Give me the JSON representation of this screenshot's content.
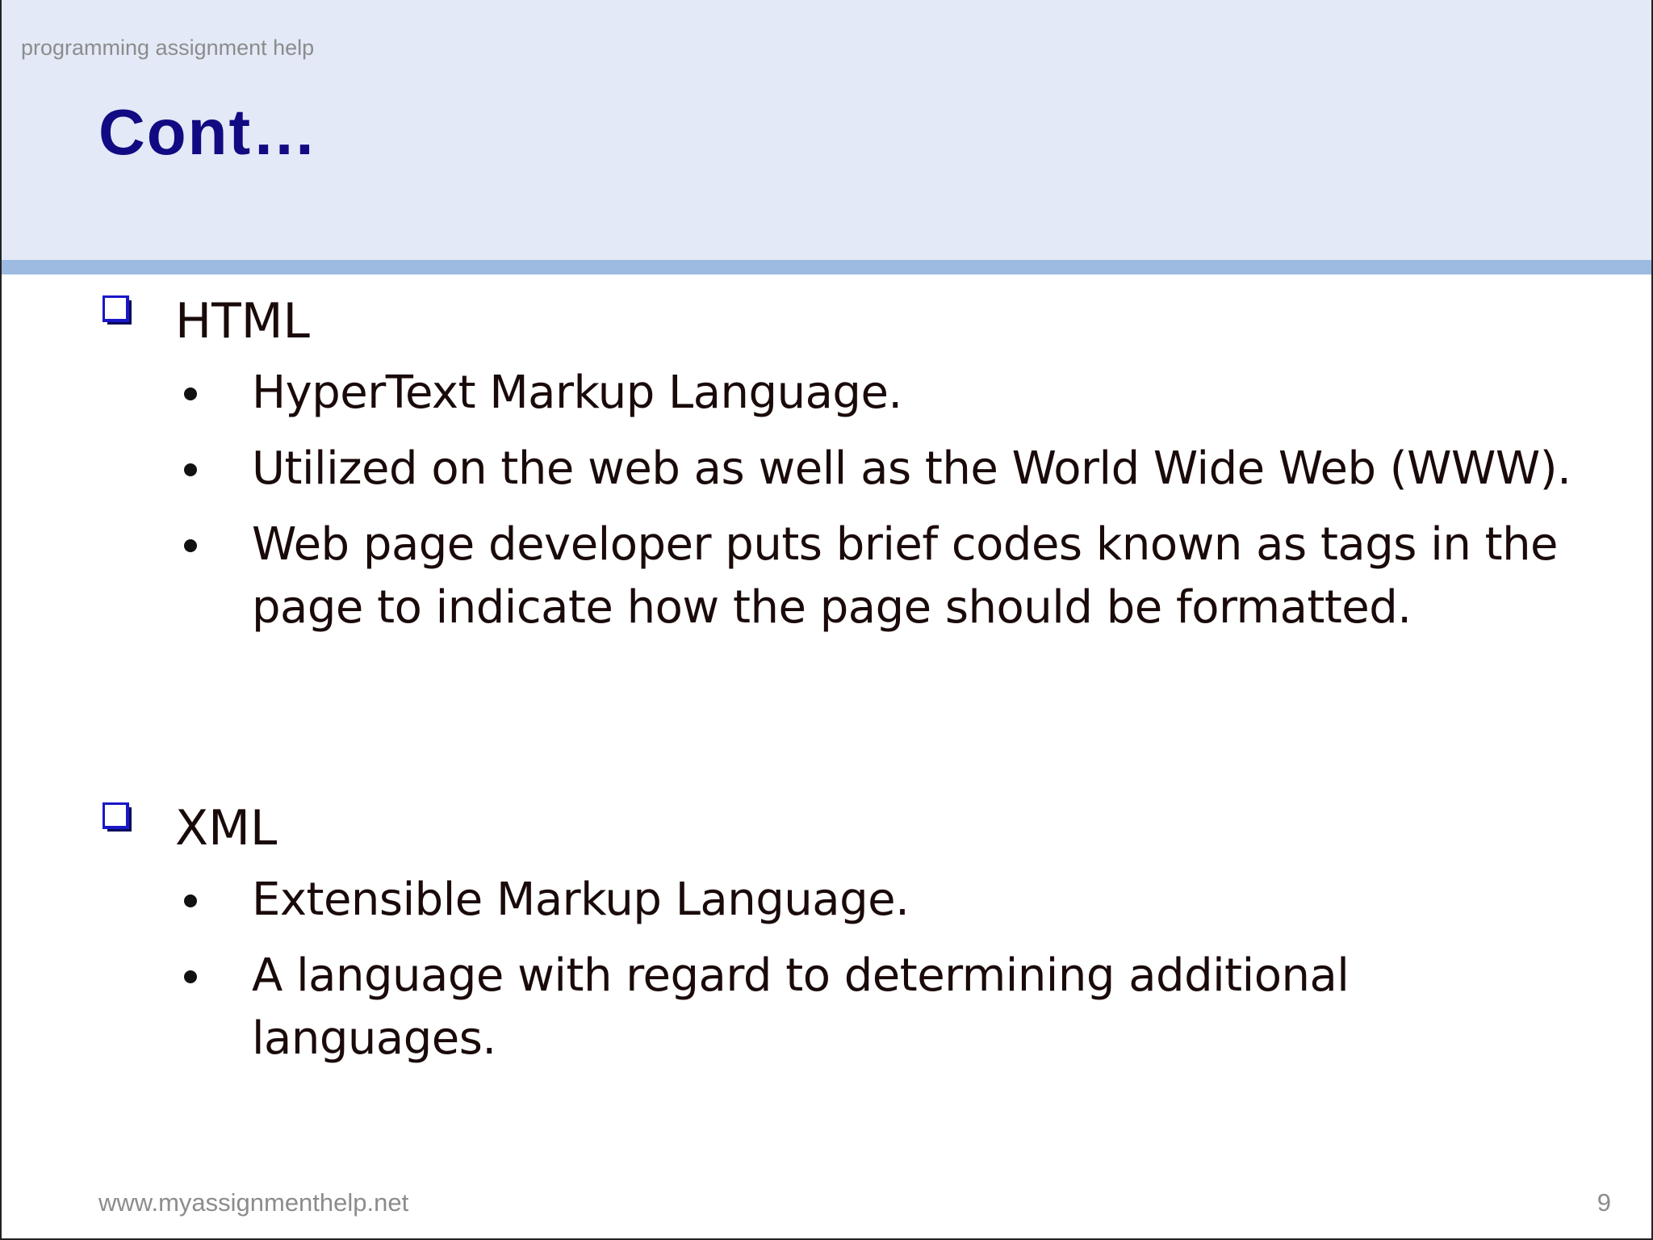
{
  "header": {
    "watermark": "programming assignment help",
    "title": "Cont…"
  },
  "sections": [
    {
      "label": "HTML",
      "icon": "checkbox-icon",
      "bullets": [
        "HyperText Markup Language.",
        "Utilized on the web as well as the World Wide Web (WWW).",
        "Web page developer puts brief codes known as tags in the page to indicate how the page should be formatted."
      ]
    },
    {
      "label": "XML",
      "icon": "checkbox-icon",
      "bullets": [
        "Extensible Markup Language.",
        "A language with regard to determining additional languages."
      ]
    }
  ],
  "footer": {
    "url": "www.myassignmenthelp.net",
    "page_number": "9"
  },
  "colors": {
    "header_bg": "#e3e9f6",
    "header_rule": "#9dbbe0",
    "title": "#120a82",
    "checkbox": "#1a17c8"
  }
}
